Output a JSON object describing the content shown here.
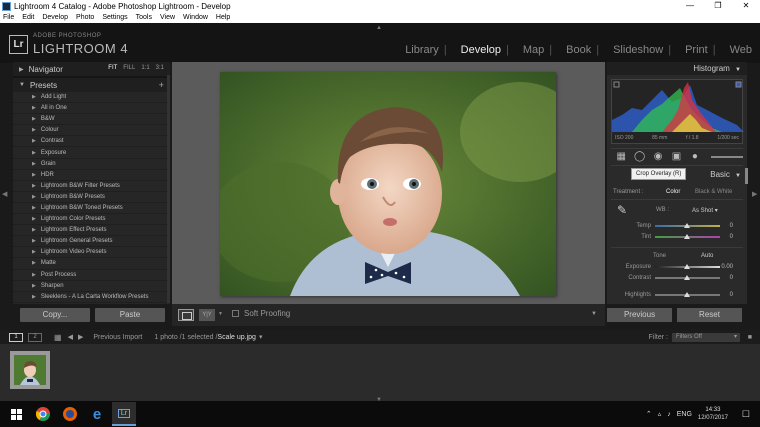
{
  "window": {
    "title": "Lightroom 4 Catalog - Adobe Photoshop Lightroom - Develop"
  },
  "menu": [
    "File",
    "Edit",
    "Develop",
    "Photo",
    "Settings",
    "Tools",
    "View",
    "Window",
    "Help"
  ],
  "brand": {
    "logo": "Lr",
    "top": "ADOBE PHOTOSHOP",
    "main": "LIGHTROOM 4"
  },
  "modules": [
    {
      "label": "Library",
      "active": false
    },
    {
      "label": "Develop",
      "active": true
    },
    {
      "label": "Map",
      "active": false
    },
    {
      "label": "Book",
      "active": false
    },
    {
      "label": "Slideshow",
      "active": false
    },
    {
      "label": "Print",
      "active": false
    },
    {
      "label": "Web",
      "active": false
    }
  ],
  "navigator": {
    "title": "Navigator",
    "fit": "FIT",
    "fill": "FILL",
    "one": "1:1",
    "ratio": "3:1"
  },
  "presets": {
    "title": "Presets",
    "items": [
      "Add Light",
      "All in One",
      "B&W",
      "Colour",
      "Contrast",
      "Exposure",
      "Grain",
      "HDR",
      "Lightroom B&W Filter Presets",
      "Lightroom B&W Presets",
      "Lightroom B&W Toned Presets",
      "Lightroom Color Presets",
      "Lightroom Effect Presets",
      "Lightroom General Presets",
      "Lightroom Video Presets",
      "Matte",
      "Post Process",
      "Sharpen",
      "Sleeklens - A La Carta Workflow Presets"
    ]
  },
  "left_buttons": {
    "copy": "Copy...",
    "paste": "Paste"
  },
  "toolbar": {
    "yy": "Y|Y",
    "soft_proofing": "Soft Proofing"
  },
  "histogram": {
    "title": "Histogram",
    "iso": "ISO 200",
    "focal": "85 mm",
    "aperture": "f / 1.8",
    "shutter": "1/200 sec"
  },
  "tooltip": "Crop Overlay (R)",
  "basic": {
    "title": "Basic",
    "treatment_label": "Treatment :",
    "color": "Color",
    "bw": "Black & White",
    "wb_label": "WB :",
    "wb_value": "As Shot",
    "tone_label": "Tone",
    "auto": "Auto",
    "sliders": [
      {
        "name": "Temp",
        "value": "0",
        "pos": 0.5
      },
      {
        "name": "Tint",
        "value": "0",
        "pos": 0.5
      },
      {
        "name": "Exposure",
        "value": "0.00",
        "pos": 0.5
      },
      {
        "name": "Contrast",
        "value": "0",
        "pos": 0.5
      },
      {
        "name": "Highlights",
        "value": "0",
        "pos": 0.5
      }
    ]
  },
  "right_buttons": {
    "previous": "Previous",
    "reset": "Reset"
  },
  "filmbar": {
    "page1": "1",
    "page2": "2",
    "source": "Previous Import",
    "count": "1 photo /1 selected /",
    "filename": "Scale up.jpg",
    "filter_label": "Filter :",
    "filter_value": "Filters Off"
  },
  "taskbar": {
    "lang": "ENG",
    "time": "14:33",
    "date": "12/07/2017"
  },
  "colors": {
    "panel": "#2a2a2a",
    "center": "#5b5b5b",
    "accent": "#6aa0d8"
  }
}
